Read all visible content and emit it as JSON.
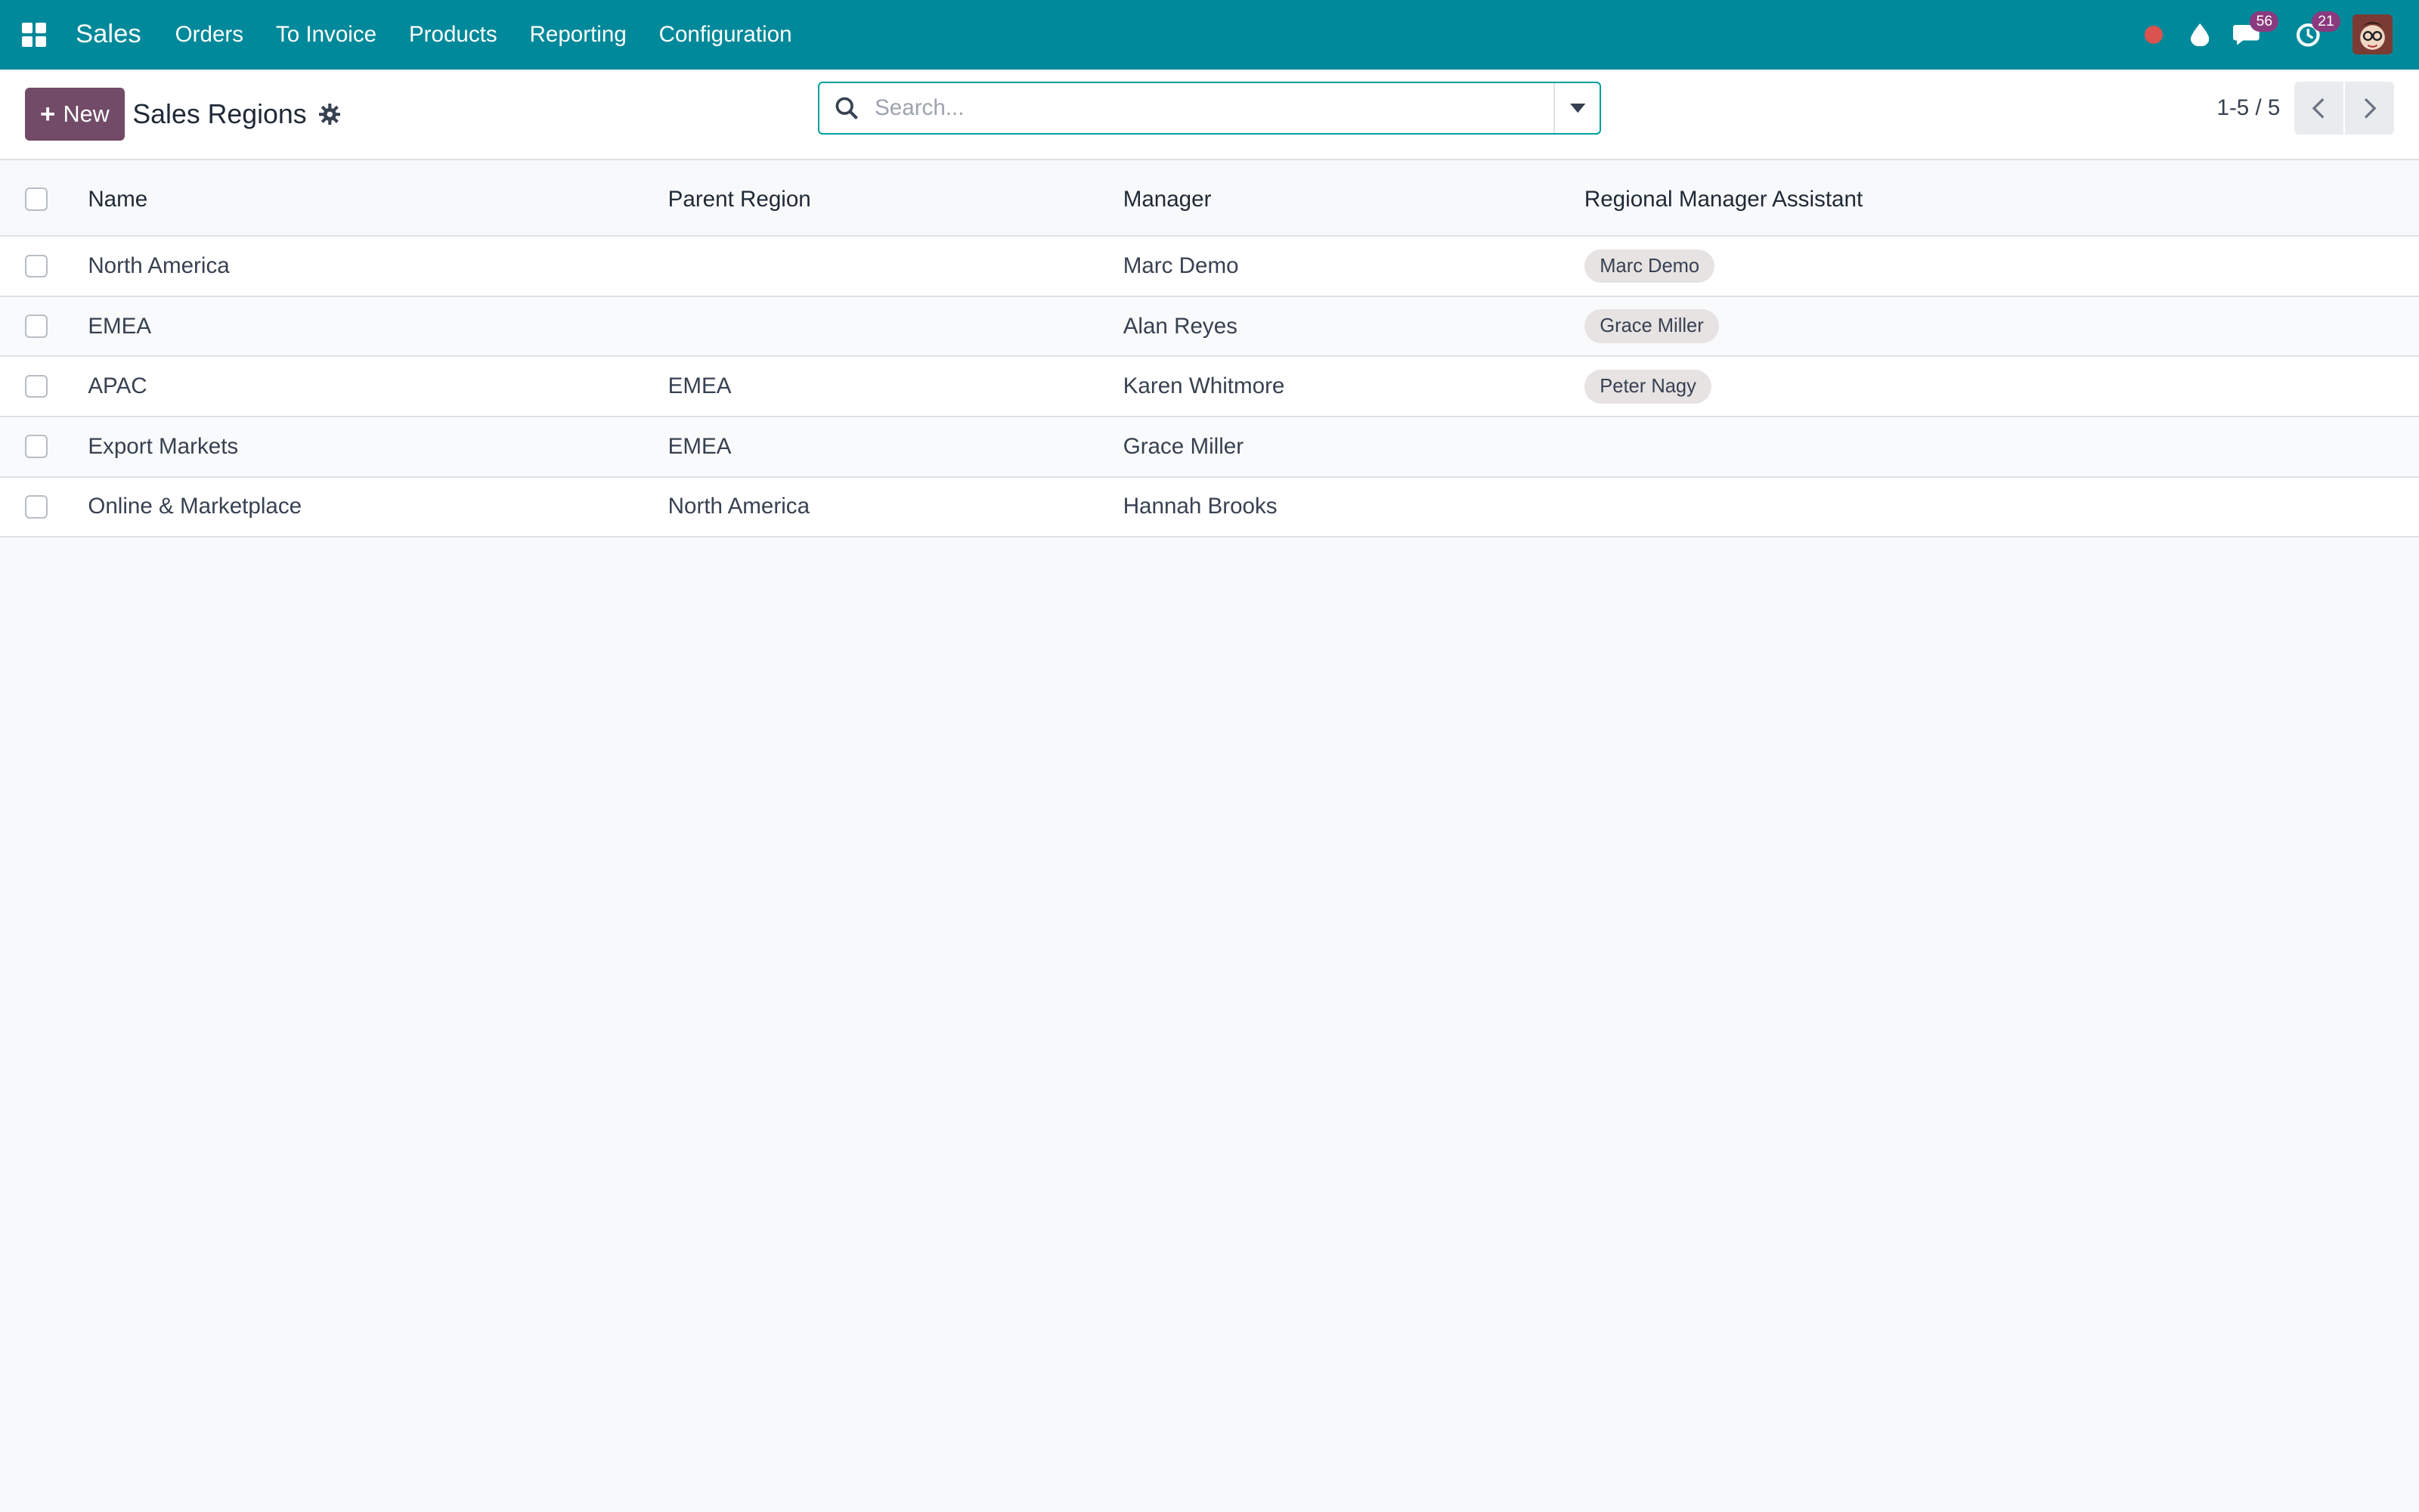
{
  "navbar": {
    "app_name": "Sales",
    "menu": [
      "Orders",
      "To Invoice",
      "Products",
      "Reporting",
      "Configuration"
    ],
    "messages_count": "56",
    "activities_count": "21",
    "accent_color": "#00899a"
  },
  "control": {
    "new_label": "New",
    "title": "Sales Regions",
    "search_placeholder": "Search...",
    "pager_value": "1-5 / 5",
    "brand_color": "#714b67"
  },
  "table": {
    "headers": {
      "name": "Name",
      "parent": "Parent Region",
      "manager": "Manager",
      "assistant": "Regional Manager Assistant"
    },
    "rows": [
      {
        "name": "North America",
        "parent": "",
        "manager": "Marc Demo",
        "assistant": "Marc Demo"
      },
      {
        "name": "EMEA",
        "parent": "",
        "manager": "Alan Reyes",
        "assistant": "Grace Miller"
      },
      {
        "name": "APAC",
        "parent": "EMEA",
        "manager": "Karen Whitmore",
        "assistant": "Peter Nagy"
      },
      {
        "name": "Export Markets",
        "parent": "EMEA",
        "manager": "Grace Miller",
        "assistant": ""
      },
      {
        "name": "Online & Marketplace",
        "parent": "North America",
        "manager": "Hannah Brooks",
        "assistant": ""
      }
    ]
  }
}
